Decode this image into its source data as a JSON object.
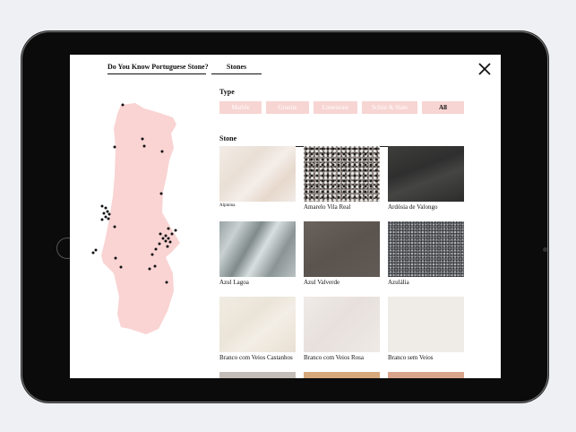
{
  "nav": {
    "tab_intro": "Do You Know Portuguese Stone?",
    "tab_stones": "Stones"
  },
  "close_icon": "close-icon",
  "type_section": {
    "title": "Type",
    "filters": [
      "Marble",
      "Granite",
      "Limestone",
      "Schist & Slate",
      "All"
    ],
    "active": "All"
  },
  "stone_section": {
    "title": "Stone",
    "items": [
      {
        "name": "Alpinina"
      },
      {
        "name": "Amarelo Vila Real"
      },
      {
        "name": "Ardósia de Valongo"
      },
      {
        "name": "Azul Lagoa"
      },
      {
        "name": "Azul Valverde"
      },
      {
        "name": "Azulália"
      },
      {
        "name": "Branco com Veios Castanhos"
      },
      {
        "name": "Branco com Veios Rosa"
      },
      {
        "name": "Branco sem Veios"
      },
      {
        "name": ""
      },
      {
        "name": ""
      },
      {
        "name": ""
      }
    ]
  },
  "colors": {
    "map_fill": "#f9d4d3",
    "filter_bg": "#f7d5d3",
    "map_marker": "#111111"
  }
}
